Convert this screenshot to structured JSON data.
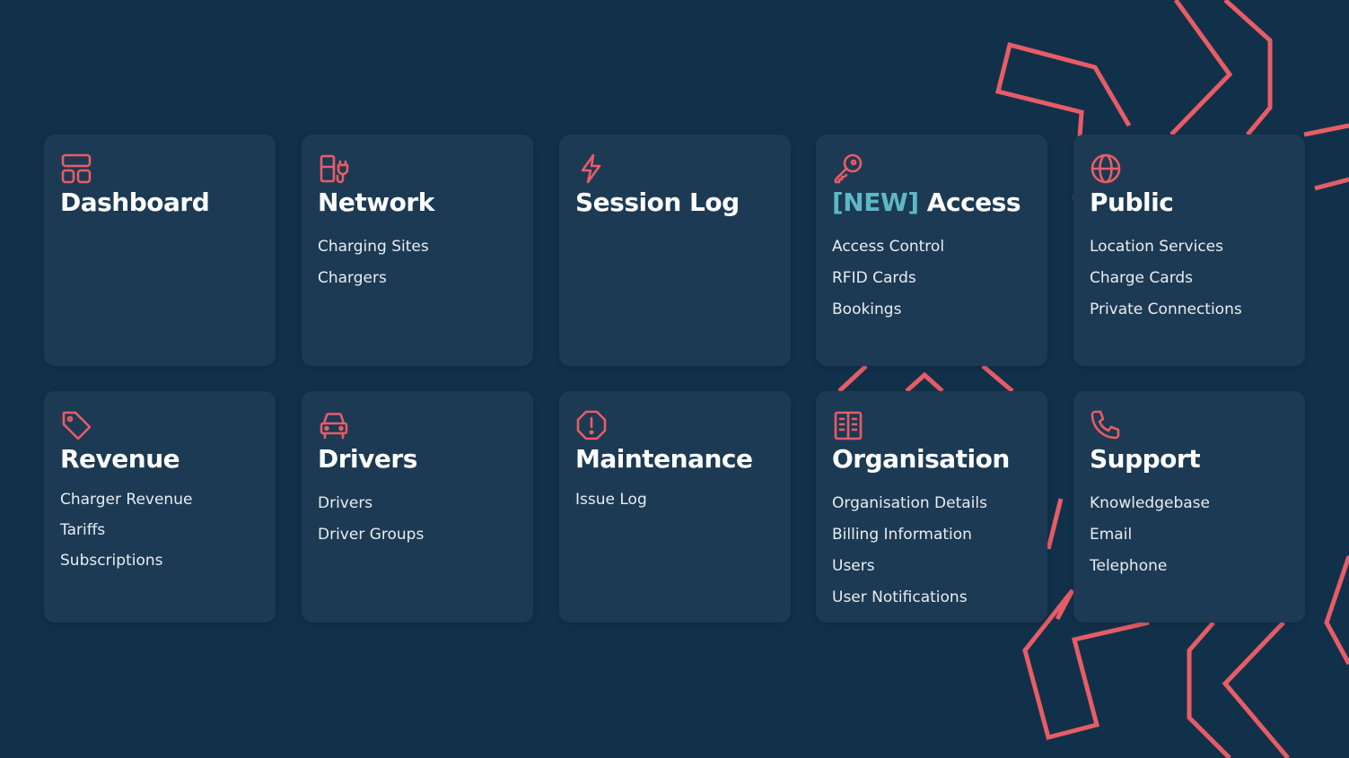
{
  "colors": {
    "background": "#11314a",
    "card": "#1c3a53",
    "accent": "#e85c66",
    "new_badge": "#5fb7c5",
    "text": "#ffffff"
  },
  "cards": [
    {
      "id": "dashboard",
      "icon": "dashboard-icon",
      "title": "Dashboard",
      "items": []
    },
    {
      "id": "network",
      "icon": "ev-station-icon",
      "title": "Network",
      "items": [
        "Charging Sites",
        "Chargers"
      ]
    },
    {
      "id": "session-log",
      "icon": "lightning-icon",
      "title": "Session Log",
      "items": []
    },
    {
      "id": "access",
      "icon": "key-icon",
      "badge": "[NEW]",
      "title": "Access",
      "items": [
        "Access Control",
        "RFID Cards",
        "Bookings"
      ]
    },
    {
      "id": "public",
      "icon": "globe-icon",
      "title": "Public",
      "items": [
        "Location Services",
        "Charge Cards",
        "Private Connections"
      ]
    },
    {
      "id": "revenue",
      "icon": "tag-icon",
      "title": "Revenue",
      "items": [
        "Charger Revenue",
        "Tariffs",
        "Subscriptions"
      ]
    },
    {
      "id": "drivers",
      "icon": "car-icon",
      "title": "Drivers",
      "items": [
        "Drivers",
        "Driver Groups"
      ]
    },
    {
      "id": "maintenance",
      "icon": "alert-icon",
      "title": "Maintenance",
      "items": [
        "Issue Log"
      ]
    },
    {
      "id": "organisation",
      "icon": "building-icon",
      "title": "Organisation",
      "items": [
        "Organisation Details",
        "Billing Information",
        "Users",
        "User Notifications"
      ]
    },
    {
      "id": "support",
      "icon": "phone-icon",
      "title": "Support",
      "items": [
        "Knowledgebase",
        "Email",
        "Telephone"
      ]
    }
  ]
}
